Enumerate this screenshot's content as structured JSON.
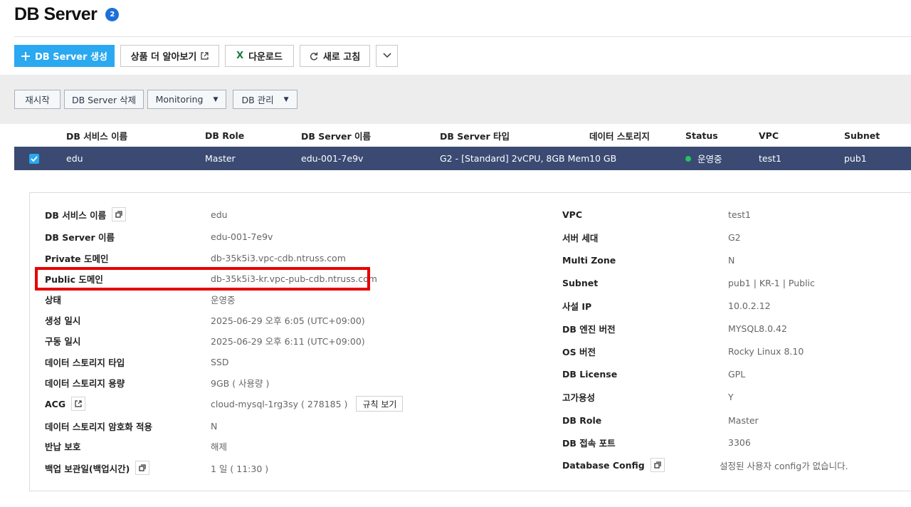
{
  "header": {
    "title": "DB Server",
    "count": "2"
  },
  "toolbar": {
    "create_label": "DB Server 생성",
    "learn_more_label": "상품 더 알아보기",
    "download_label": "다운로드",
    "download_icon": "X",
    "refresh_label": "새로 고침"
  },
  "actions": {
    "restart": "재시작",
    "delete": "DB Server 삭제",
    "monitoring": "Monitoring",
    "db_manage": "DB 관리"
  },
  "table": {
    "columns": [
      "DB 서비스 이름",
      "DB Role",
      "DB Server 이름",
      "DB Server 타입",
      "데이터 스토리지",
      "Status",
      "VPC",
      "Subnet"
    ],
    "row": {
      "service_name": "edu",
      "role": "Master",
      "server_name": "edu-001-7e9v",
      "server_type": "G2 - [Standard] 2vCPU, 8GB Mem",
      "storage": "10 GB",
      "status": "운영중",
      "vpc": "test1",
      "subnet": "pub1"
    }
  },
  "details": {
    "left": [
      {
        "label": "DB 서비스 이름",
        "value": "edu"
      },
      {
        "label": "DB Server 이름",
        "value": "edu-001-7e9v"
      },
      {
        "label": "Private 도메인",
        "value": "db-35k5i3.vpc-cdb.ntruss.com"
      },
      {
        "label": "Public 도메인",
        "value": "db-35k5i3-kr.vpc-pub-cdb.ntruss.com"
      },
      {
        "label": "상태",
        "value": "운영중"
      },
      {
        "label": "생성 일시",
        "value": "2025-06-29 오후 6:05 (UTC+09:00)"
      },
      {
        "label": "구동 일시",
        "value": "2025-06-29 오후 6:11 (UTC+09:00)"
      },
      {
        "label": "데이터 스토리지 타입",
        "value": "SSD"
      },
      {
        "label": "데이터 스토리지 용량",
        "value": "9GB ( 사용량 )"
      },
      {
        "label": "ACG",
        "value": "cloud-mysql-1rg3sy ( 278185 )"
      },
      {
        "label": "데이터 스토리지 암호화 적용",
        "value": "N"
      },
      {
        "label": "반납 보호",
        "value": "해제"
      },
      {
        "label": "백업 보관일(백업시간)",
        "value": "1 일 ( 11:30 )"
      }
    ],
    "acg_rule_button": "규칙 보기",
    "right": [
      {
        "label": "VPC",
        "value": "test1"
      },
      {
        "label": "서버 세대",
        "value": "G2"
      },
      {
        "label": "Multi Zone",
        "value": "N"
      },
      {
        "label": "Subnet",
        "value": "pub1 | KR-1 | Public"
      },
      {
        "label": "사설 IP",
        "value": "10.0.2.12"
      },
      {
        "label": "DB 엔진 버전",
        "value": "MYSQL8.0.42"
      },
      {
        "label": "OS 버전",
        "value": "Rocky Linux 8.10"
      },
      {
        "label": "DB License",
        "value": "GPL"
      },
      {
        "label": "고가용성",
        "value": "Y"
      },
      {
        "label": "DB Role",
        "value": "Master"
      },
      {
        "label": "DB 접속 포트",
        "value": "3306"
      },
      {
        "label": "Database Config",
        "value": "설정된 사용자 config가 없습니다."
      }
    ]
  },
  "colors": {
    "primary": "#2aa8f0",
    "selected_row": "#3a4a73",
    "status_ok": "#22c55e",
    "highlight": "#e60000"
  }
}
